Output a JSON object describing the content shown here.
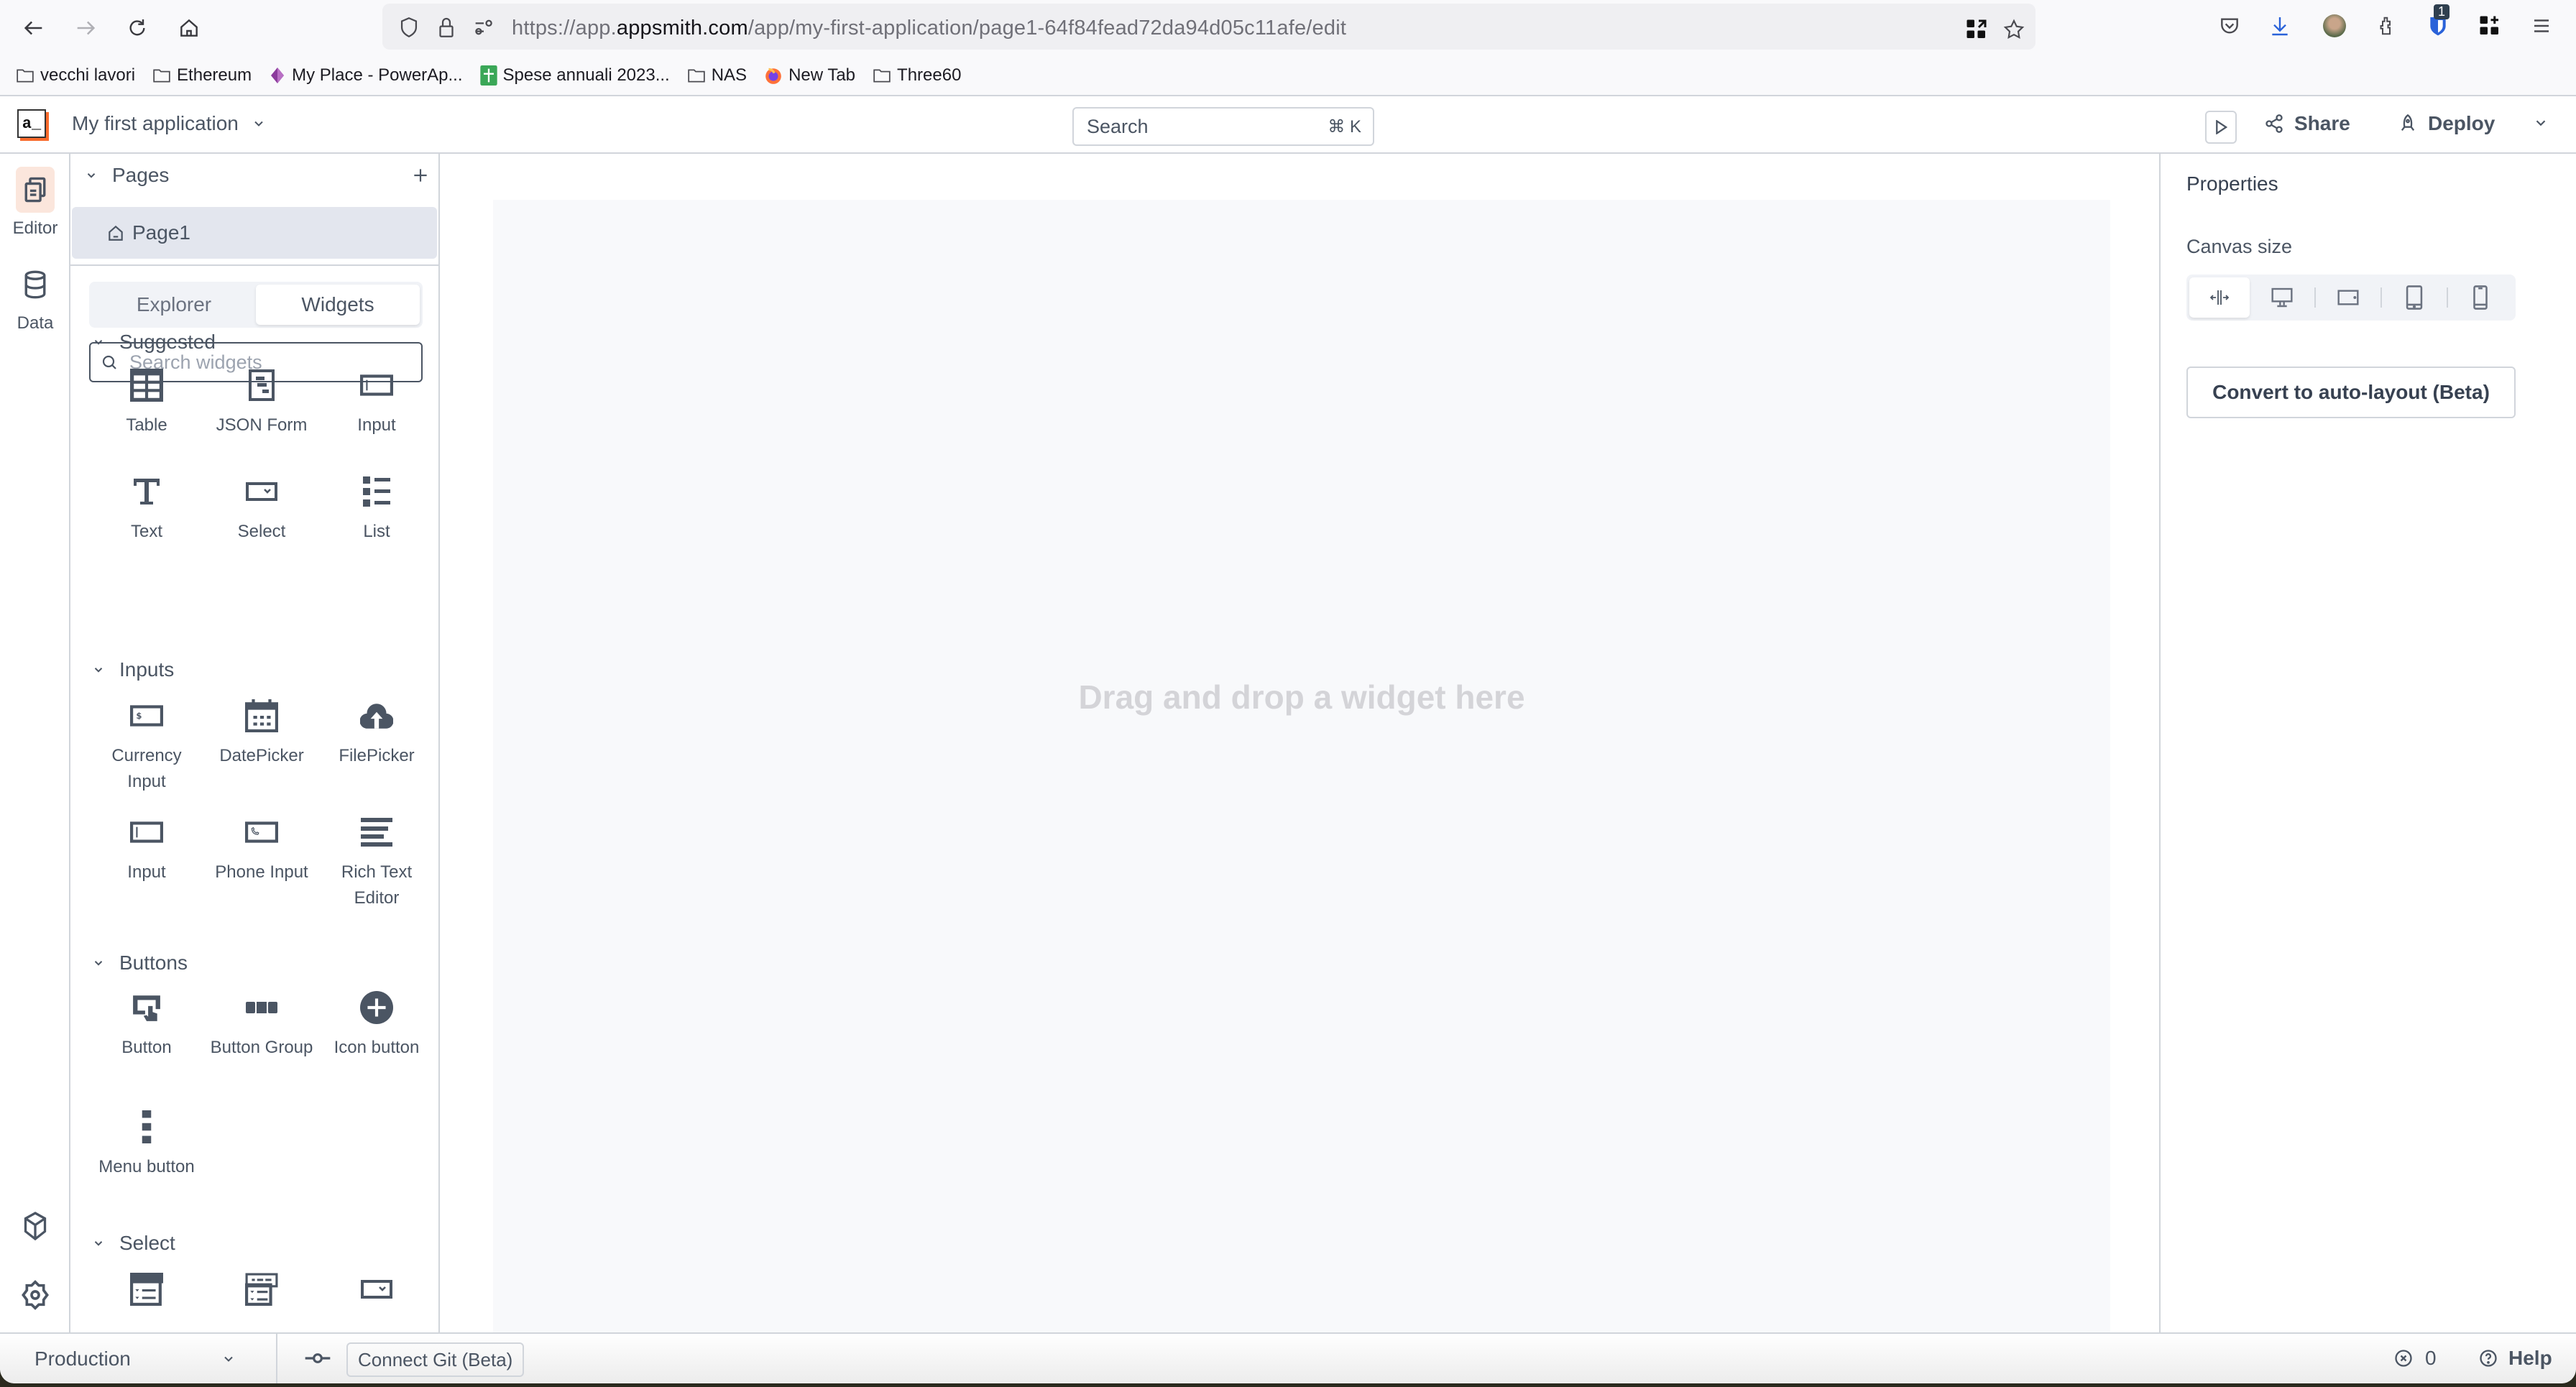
{
  "browser": {
    "url_prefix": "https://app.",
    "url_domain": "appsmith.com",
    "url_path": "/app/my-first-application/page1-64f84fead72da94d05c11afe/edit",
    "extension_badge": "1",
    "bookmarks": [
      {
        "label": "vecchi lavori",
        "icon": "folder-icon"
      },
      {
        "label": "Ethereum",
        "icon": "folder-icon"
      },
      {
        "label": "My Place - PowerAp...",
        "icon": "powerapps-icon"
      },
      {
        "label": "Spese annuali 2023...",
        "icon": "sheets-icon"
      },
      {
        "label": "NAS",
        "icon": "folder-icon"
      },
      {
        "label": "New Tab",
        "icon": "firefox-icon"
      },
      {
        "label": "Three60",
        "icon": "folder-icon"
      }
    ]
  },
  "header": {
    "logo_text": "a_",
    "app_name": "My first application",
    "search_placeholder": "Search",
    "search_shortcut": "⌘ K",
    "share_label": "Share",
    "deploy_label": "Deploy"
  },
  "rail": {
    "items": [
      {
        "label": "Editor",
        "icon": "editor-icon",
        "active": true
      },
      {
        "label": "Data",
        "icon": "database-icon",
        "active": false
      }
    ]
  },
  "sidebar": {
    "pages_title": "Pages",
    "pages": [
      {
        "label": "Page1",
        "home": true
      }
    ],
    "tabs": [
      {
        "label": "Explorer",
        "active": false
      },
      {
        "label": "Widgets",
        "active": true
      }
    ],
    "search_placeholder": "Search widgets",
    "sections": [
      {
        "title": "Suggested",
        "widgets": [
          {
            "label": "Table",
            "icon": "table-icon"
          },
          {
            "label": "JSON Form",
            "icon": "json-form-icon"
          },
          {
            "label": "Input",
            "icon": "input-icon"
          },
          {
            "label": "Text",
            "icon": "text-icon"
          },
          {
            "label": "Select",
            "icon": "select-icon"
          },
          {
            "label": "List",
            "icon": "list-icon"
          }
        ]
      },
      {
        "title": "Inputs",
        "widgets": [
          {
            "label": "Currency Input",
            "icon": "currency-input-icon"
          },
          {
            "label": "DatePicker",
            "icon": "datepicker-icon"
          },
          {
            "label": "FilePicker",
            "icon": "filepicker-icon"
          },
          {
            "label": "Input",
            "icon": "input-icon"
          },
          {
            "label": "Phone Input",
            "icon": "phone-input-icon"
          },
          {
            "label": "Rich Text Editor",
            "icon": "rich-text-editor-icon"
          }
        ]
      },
      {
        "title": "Buttons",
        "widgets": [
          {
            "label": "Button",
            "icon": "button-icon"
          },
          {
            "label": "Button Group",
            "icon": "button-group-icon"
          },
          {
            "label": "Icon button",
            "icon": "icon-button-icon"
          },
          {
            "label": "Menu button",
            "icon": "menu-button-icon"
          }
        ]
      },
      {
        "title": "Select",
        "widgets": [
          {
            "label": "",
            "icon": "multi-tree-select-icon"
          },
          {
            "label": "",
            "icon": "multi-select-icon"
          },
          {
            "label": "",
            "icon": "select-icon"
          }
        ]
      }
    ]
  },
  "canvas": {
    "empty_hint": "Drag and drop a widget here"
  },
  "properties": {
    "title": "Properties",
    "canvas_size_label": "Canvas size",
    "canvas_size_options": [
      {
        "name": "fluid",
        "active": true
      },
      {
        "name": "desktop",
        "active": false
      },
      {
        "name": "tablet-landscape",
        "active": false
      },
      {
        "name": "tablet",
        "active": false
      },
      {
        "name": "mobile",
        "active": false
      }
    ],
    "convert_label": "Convert to auto-layout (Beta)"
  },
  "footer": {
    "environment": "Production",
    "connect_git_label": "Connect Git (Beta)",
    "error_count": "0",
    "help_label": "Help"
  },
  "colors": {
    "brand_orange": "#f86a2b",
    "active_rail_bg": "#fbe6dc",
    "text": "#4b5563",
    "border": "#d1d5db"
  }
}
